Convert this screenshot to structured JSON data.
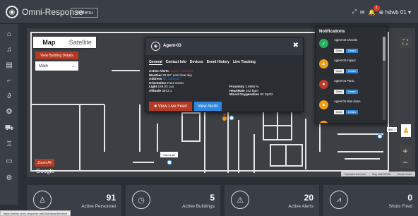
{
  "app": {
    "brand": "Omni-Response",
    "menu_label": "Menu"
  },
  "topbar": {
    "notif_count": "1",
    "user_label": "hdwb 01"
  },
  "map": {
    "tab_map": "Map",
    "tab_satellite": "Satellite",
    "building_details_label": "View Building Details",
    "building_select_value": "Main",
    "zoom_all_label": "Zoom All",
    "google_label": "Google",
    "attribution": [
      "Keyboard shortcuts",
      "Map data ©2025",
      "Terms of Use"
    ],
    "cam_label": "Cam-Lab",
    "badge_865": "865 3"
  },
  "popup": {
    "title": "Agent-03",
    "tabs": [
      "General",
      "Contact Info",
      "Devices",
      "Event History",
      "Live Tracking"
    ],
    "info_left": [
      {
        "label": "Active Alerts",
        "value": "Impact, Checkin",
        "color": "red"
      },
      {
        "label": "Weather",
        "value": "83.03° and clear sky",
        "color": ""
      },
      {
        "label": "Address",
        "value": "No Address",
        "color": "blue"
      },
      {
        "label": "Orientation",
        "value": "Face Down",
        "color": ""
      },
      {
        "label": "Light",
        "value": "159.03 Lux",
        "color": ""
      },
      {
        "label": "Altitude",
        "value": "3672.1",
        "color": ""
      }
    ],
    "info_right": [
      {
        "label": "Proximity",
        "value": "1.9685 %"
      },
      {
        "label": "HeartRate",
        "value": "102 bpm"
      },
      {
        "label": "Blood Oxygenation",
        "value": "92 SpO2"
      }
    ],
    "live_feed_label": "View Live Feed",
    "alerts_label": "View Alerts"
  },
  "notifications": {
    "title": "Notifications",
    "items": [
      {
        "name": "Agent-03 Checkin",
        "time": "",
        "color": "#27ae60",
        "icon": "✓"
      },
      {
        "name": "Agent-03 Impact",
        "time": "",
        "color": "#f39c12",
        "icon": "!"
      },
      {
        "name": "Agent-04 Panic",
        "time": "",
        "color": "#c0392b",
        "icon": "!"
      },
      {
        "name": "Agent-04 Man down",
        "time": "",
        "color": "#f39c12",
        "icon": "!"
      }
    ],
    "clear_label": "Clear",
    "details_label": "Details"
  },
  "stats": [
    {
      "value": "91",
      "label": "Active Personnel",
      "icon": "person-icon"
    },
    {
      "value": "5",
      "label": "Active Buildings",
      "icon": "clock-icon"
    },
    {
      "value": "20",
      "label": "Active Alerts",
      "icon": "warning-icon"
    },
    {
      "value": "0",
      "label": "Shots Fired",
      "icon": "chart-icon"
    }
  ],
  "status_url": "https://demo.omni-response.net/Dashboard/Index#"
}
